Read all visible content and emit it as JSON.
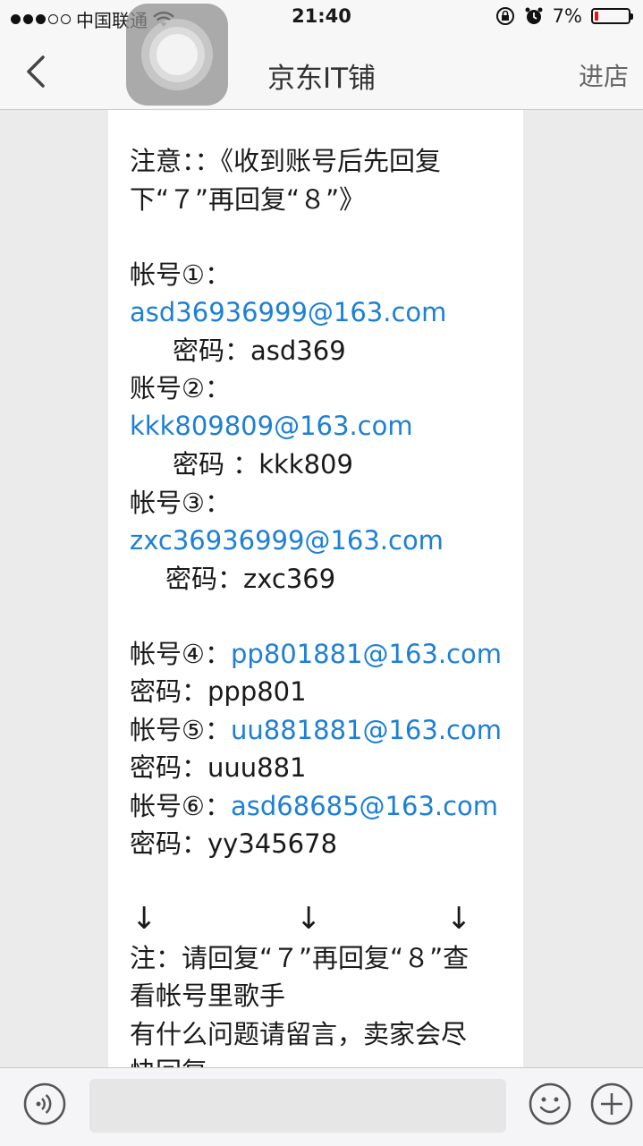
{
  "status_bar": {
    "carrier": "中国联通",
    "time": "21:40",
    "battery": "7%"
  },
  "nav": {
    "title": "京东IT铺",
    "right_label": "进店"
  },
  "message": {
    "notice_1": "注意：：《收到账号后先回复",
    "notice_2": "下“７”再回复“８”》",
    "acc1_label": "帐号①：",
    "acc1_email": "asd36936999@163.com",
    "acc1_pwd": "密码：asd369",
    "acc2_label": "账号②：",
    "acc2_email": "kkk809809@163.com",
    "acc2_pwd": "密码 ：kkk809",
    "acc3_label": "帐号③：",
    "acc3_email": "zxc36936999@163.com",
    "acc3_pwd": "密码：zxc369",
    "acc4_label": "帐号④：",
    "acc4_email": "pp801881@163.com",
    "acc4_pwd": "密码：ppp801",
    "acc5_label": "帐号⑤：",
    "acc5_email": "uu881881@163.com",
    "acc5_pwd": "密码：uuu881",
    "acc6_label": "帐号⑥：",
    "acc6_email": "asd68685@163.com",
    "acc6_pwd": "密码：yy345678",
    "arrow": "↓",
    "note_1": "注：请回复“７”再回复“８”查",
    "note_2": "看帐号里歌手",
    "note_3": "有什么问题请留言，卖家会尽",
    "note_4": "快回复"
  },
  "input_bar": {
    "placeholder": ""
  },
  "icons": {
    "voice": "voice-icon",
    "emoji": "emoji-icon",
    "plus": "plus-icon",
    "back": "chevron-left-icon"
  },
  "colors": {
    "link": "#1d7fd6",
    "battery_low": "#e11111"
  }
}
